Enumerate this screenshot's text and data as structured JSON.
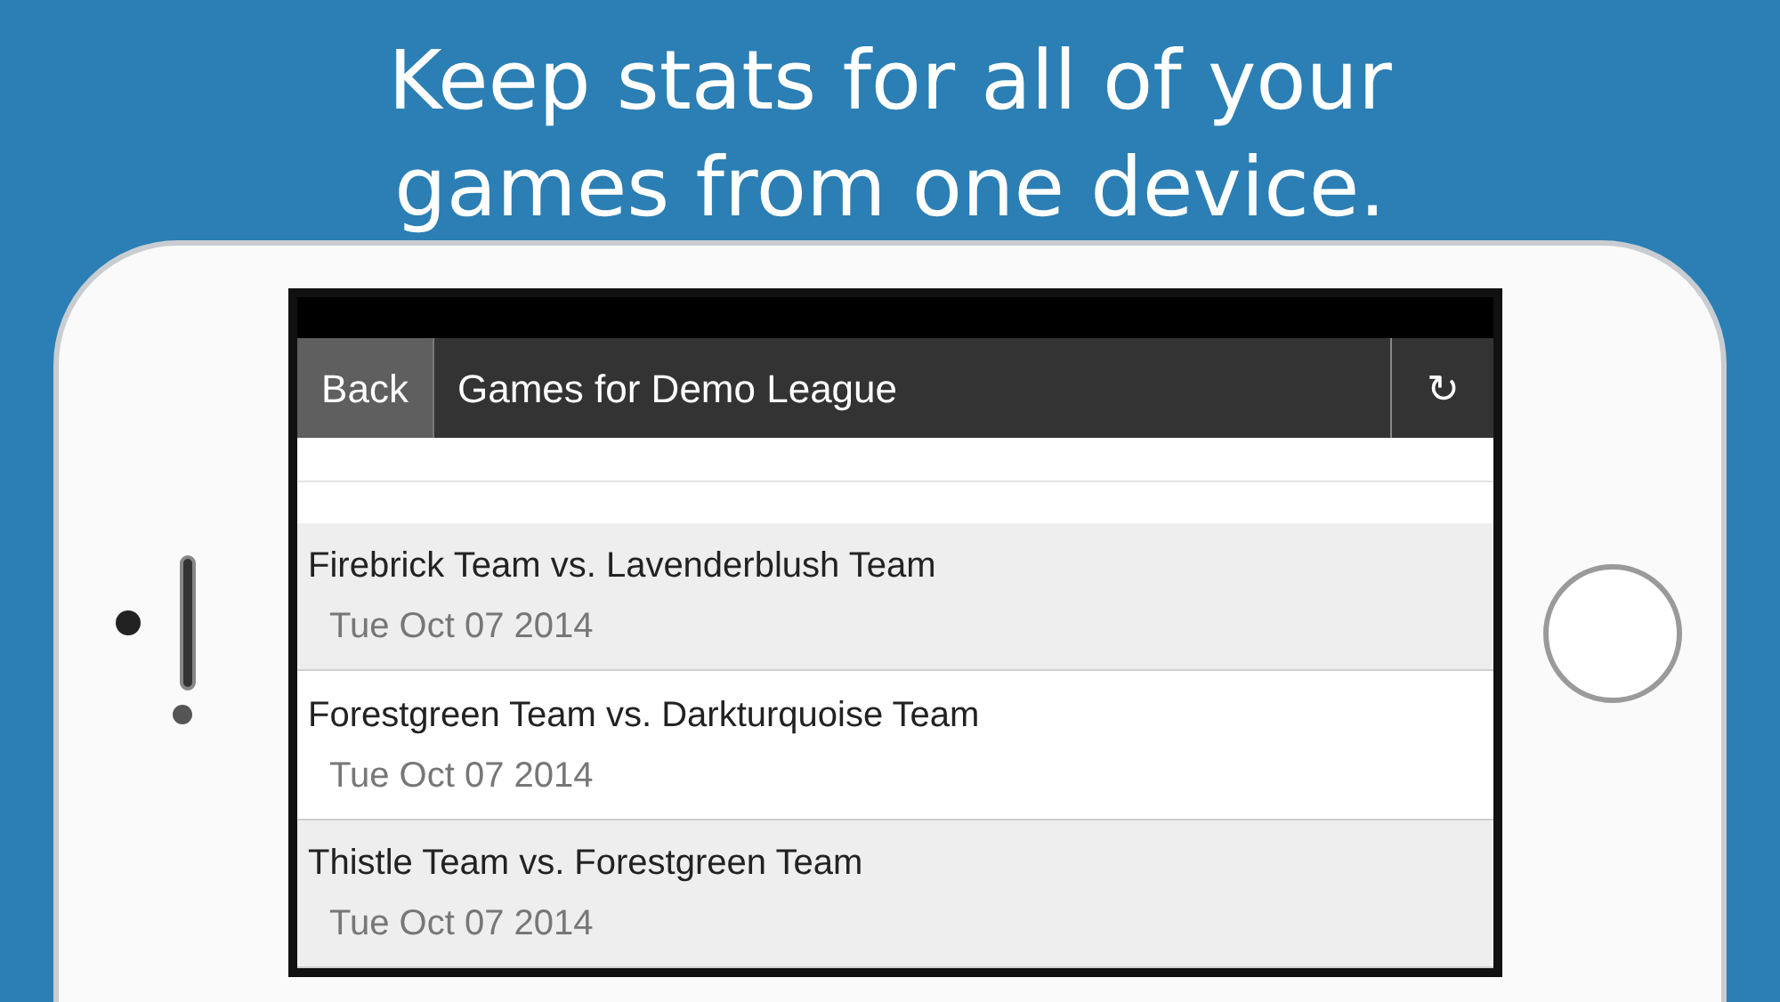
{
  "headline_lines": [
    "Keep stats for all of your",
    "games from one device."
  ],
  "header": {
    "back": "Back",
    "title": "Games for Demo League",
    "refresh": "↻"
  },
  "games": [
    {
      "title": "Firebrick Team vs. Lavenderblush Team",
      "date": "Tue Oct 07 2014"
    },
    {
      "title": "Forestgreen Team vs. Darkturquoise Team",
      "date": "Tue Oct 07 2014"
    },
    {
      "title": "Thistle Team vs. Forestgreen Team",
      "date": "Tue Oct 07 2014"
    }
  ]
}
